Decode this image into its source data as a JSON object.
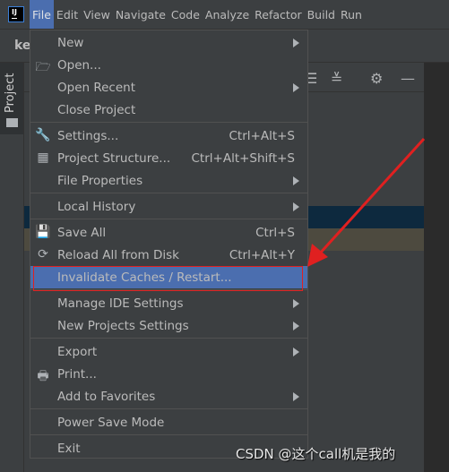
{
  "menubar": {
    "items": [
      {
        "label": "File",
        "mn": "F",
        "active": true
      },
      {
        "label": "Edit",
        "mn": "E"
      },
      {
        "label": "View",
        "mn": "V"
      },
      {
        "label": "Navigate",
        "mn": "N"
      },
      {
        "label": "Code",
        "mn": "C"
      },
      {
        "label": "Analyze",
        "mn": "z"
      },
      {
        "label": "Refactor",
        "mn": "R"
      },
      {
        "label": "Build",
        "mn": "B"
      },
      {
        "label": "Run",
        "mn": "u"
      }
    ]
  },
  "logo_text": "IJ",
  "editor_tab": "ke",
  "tool_window": {
    "label": "Project"
  },
  "file_menu": {
    "items": [
      {
        "label": "New",
        "mn": "N",
        "submenu": true
      },
      {
        "label": "Open...",
        "mn": "O",
        "icon": "folder-open-icon"
      },
      {
        "label": "Open Recent",
        "mn": "R",
        "submenu": true
      },
      {
        "label": "Close Project"
      },
      {
        "sep": true
      },
      {
        "label": "Settings...",
        "mn": "t",
        "icon": "wrench-icon",
        "shortcut": "Ctrl+Alt+S"
      },
      {
        "label": "Project Structure...",
        "icon": "project-structure-icon",
        "shortcut": "Ctrl+Alt+Shift+S"
      },
      {
        "label": "File Properties",
        "submenu": true
      },
      {
        "sep": true
      },
      {
        "label": "Local History",
        "mn": "H",
        "submenu": true
      },
      {
        "sep": true
      },
      {
        "label": "Save All",
        "mn": "S",
        "icon": "save-icon",
        "shortcut": "Ctrl+S"
      },
      {
        "label": "Reload All from Disk",
        "icon": "reload-icon",
        "shortcut": "Ctrl+Alt+Y"
      },
      {
        "label": "Invalidate Caches / Restart...",
        "selected": true
      },
      {
        "sep": true
      },
      {
        "label": "Manage IDE Settings",
        "submenu": true
      },
      {
        "label": "New Projects Settings",
        "submenu": true
      },
      {
        "sep": true
      },
      {
        "label": "Export",
        "submenu": true
      },
      {
        "label": "Print...",
        "mn": "P",
        "icon": "print-icon"
      },
      {
        "label": "Add to Favorites",
        "mn": "a",
        "submenu": true
      },
      {
        "sep": true
      },
      {
        "label": "Power Save Mode"
      },
      {
        "sep": true
      },
      {
        "label": "Exit",
        "mn": "x"
      }
    ]
  },
  "annotation_color": "#e02020",
  "watermark": "CSDN @这个call机是我的"
}
